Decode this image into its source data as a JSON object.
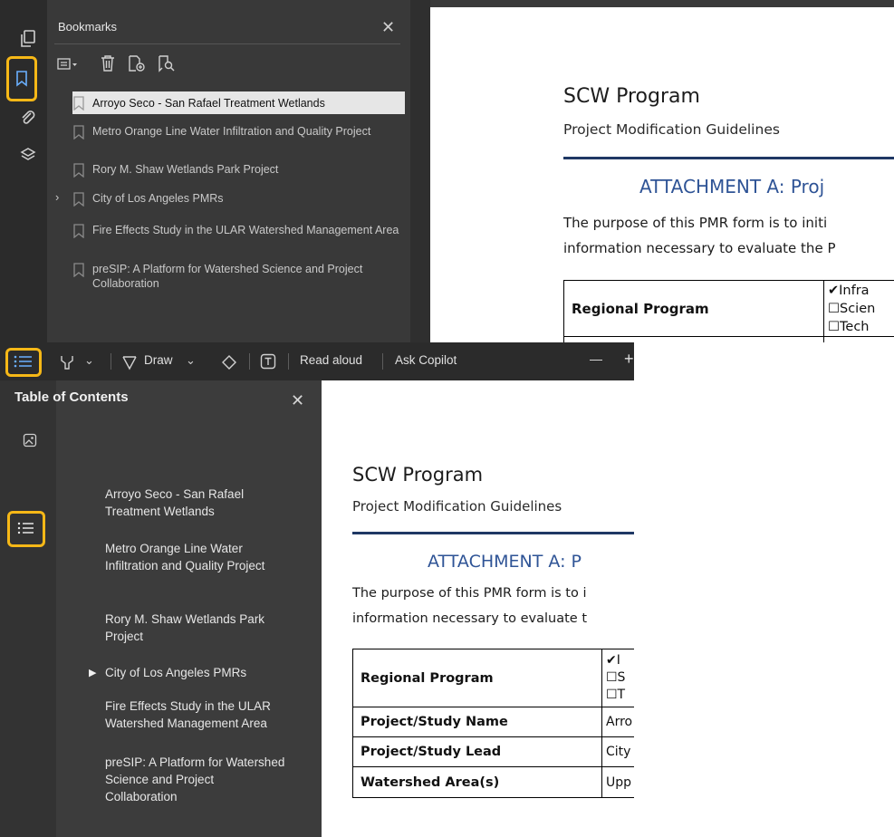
{
  "top": {
    "panel_title": "Bookmarks",
    "rail_icons": [
      "pages-icon",
      "bookmark-icon",
      "attachment-icon",
      "layers-icon"
    ],
    "bookmarks": [
      {
        "label": "Arroyo Seco - San Rafael Treatment Wetlands",
        "selected": true
      },
      {
        "label": "Metro Orange Line Water Infiltration and Quality Project"
      },
      {
        "label": "Rory M. Shaw Wetlands Park Project"
      },
      {
        "label": "City of Los Angeles PMRs",
        "expandable": true
      },
      {
        "label": "Fire Effects Study in the ULAR Watershed Management Area"
      },
      {
        "label": "preSIP: A Platform for Watershed Science and Project Collaboration"
      }
    ],
    "doc": {
      "title": "SCW Program",
      "subtitle": "Project Modification Guidelines",
      "attachment": "ATTACHMENT A: Proj",
      "para_line1": "The purpose of this PMR form is to initi",
      "para_line2": "information necessary to evaluate the P",
      "table_label": "Regional Program",
      "options": [
        "✔Infra",
        "☐Scien",
        "☐Tech"
      ]
    }
  },
  "bottom": {
    "toolbar": {
      "draw_label": "Draw",
      "read_aloud": "Read aloud",
      "ask_copilot": "Ask Copilot",
      "minus": "—",
      "plus": "+"
    },
    "toc_title": "Table of Contents",
    "toc_items": [
      "Arroyo Seco - San Rafael Treatment Wetlands",
      "Metro Orange Line Water Infiltration and Quality Project",
      "Rory M. Shaw Wetlands Park Project",
      "City of Los Angeles PMRs",
      "Fire Effects Study in the ULAR Watershed Management Area",
      "preSIP: A Platform for Watershed Science and Project Collaboration"
    ],
    "doc": {
      "title": "SCW Program",
      "subtitle": "Project Modification Guidelines",
      "attachment": "ATTACHMENT A: P",
      "para_line1": "The purpose of this PMR form is to i",
      "para_line2": "information necessary to evaluate t",
      "options": [
        "✔I",
        "☐S",
        "☐T"
      ],
      "rows": [
        {
          "label": "Regional Program",
          "value": ""
        },
        {
          "label": "Project/Study Name",
          "value": "Arro"
        },
        {
          "label": "Project/Study Lead",
          "value": "City"
        },
        {
          "label": "Watershed Area(s)",
          "value": "Upp"
        }
      ]
    }
  },
  "colors": {
    "highlight": "#f6b817",
    "doc_rule": "#1f3864",
    "attachment_blue": "#2f5496"
  }
}
